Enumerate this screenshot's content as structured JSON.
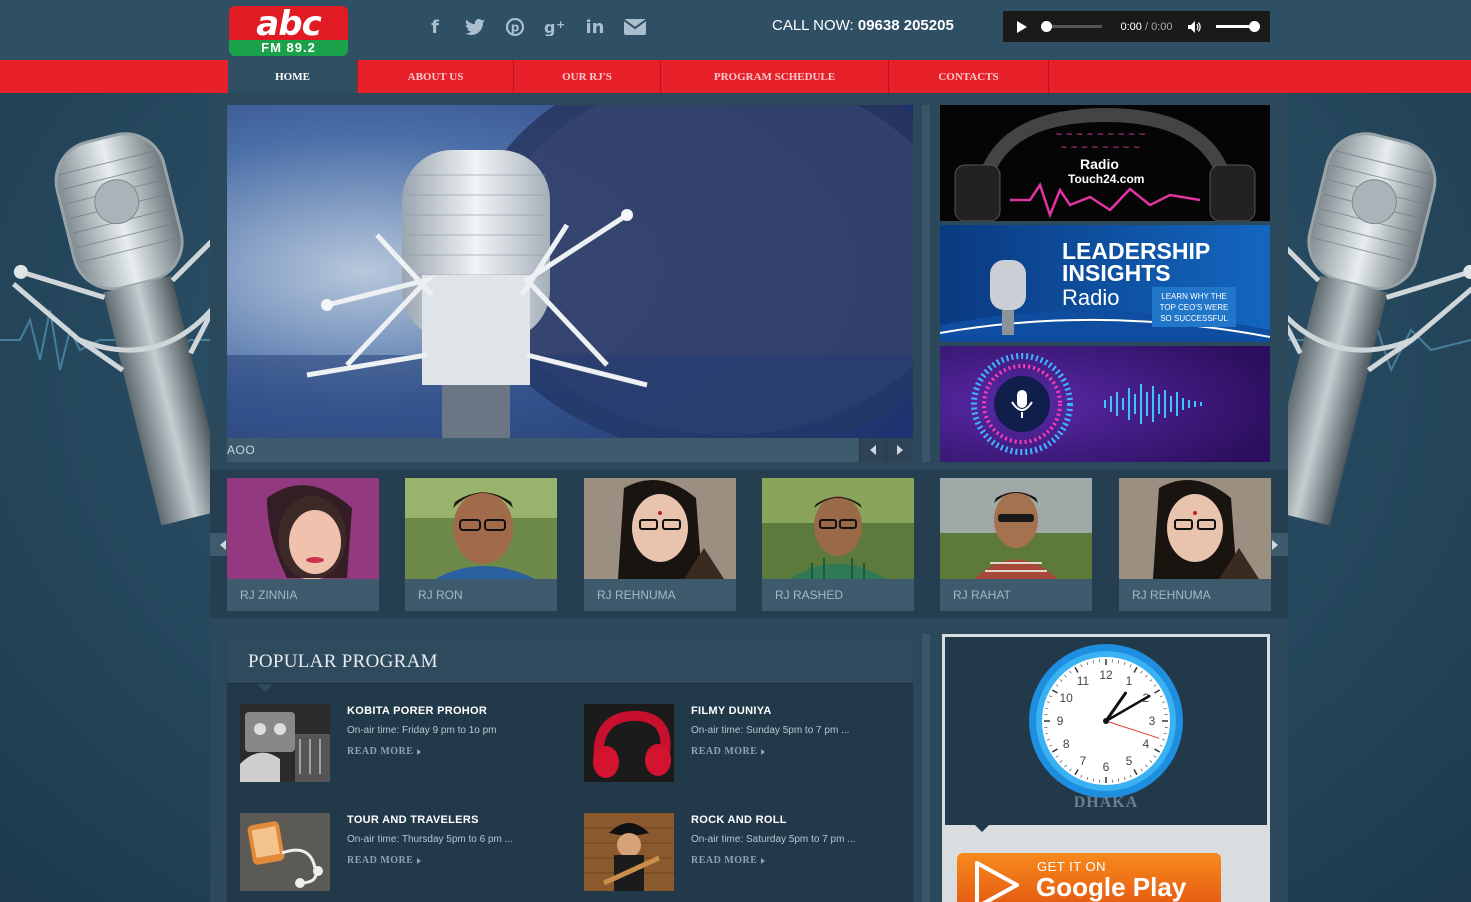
{
  "brand": {
    "logo_text": "abc",
    "logo_sub": "FM 89.2"
  },
  "header": {
    "call_label": "CALL NOW:",
    "call_number": "09638 205205",
    "social": [
      "facebook-icon",
      "twitter-icon",
      "pinterest-icon",
      "google-plus-icon",
      "linkedin-icon",
      "email-icon"
    ]
  },
  "player": {
    "current_time": "0:00",
    "separator": "/",
    "duration": "0:00",
    "progress": 0,
    "volume": 1.0
  },
  "nav": {
    "items": [
      {
        "label": "HOME",
        "active": true
      },
      {
        "label": "ABOUT US",
        "active": false
      },
      {
        "label": "OUR RJ'S",
        "active": false
      },
      {
        "label": "PROGRAM SCHEDULE",
        "active": false
      },
      {
        "label": "CONTACTS",
        "active": false
      }
    ]
  },
  "slider": {
    "caption": "AOO"
  },
  "ads": {
    "ad1_text_main": "Radio",
    "ad1_text_sub": "Touch24.com",
    "ad2_line1": "LEADERSHIP",
    "ad2_line2": "INSIGHTS",
    "ad2_line3": "Radio",
    "ad2_badge": "LEARN WHY THE TOP CEO'S WERE SO SUCCESSFUL"
  },
  "rjs": [
    {
      "name": "RJ ZINNIA"
    },
    {
      "name": "RJ RON"
    },
    {
      "name": "RJ REHNUMA"
    },
    {
      "name": "RJ RASHED"
    },
    {
      "name": "RJ RAHAT"
    },
    {
      "name": "RJ REHNUMA"
    }
  ],
  "popular": {
    "title": "POPULAR PROGRAM",
    "read_more": "READ MORE",
    "programs": [
      {
        "title": "KOBITA PORER PROHOR",
        "time": "On-air time: Friday 9 pm to 1o pm"
      },
      {
        "title": "FILMY DUNIYA",
        "time": "On-air time: Sunday 5pm to 7 pm ..."
      },
      {
        "title": "TOUR AND TRAVELERS",
        "time": "On-air time: Thursday 5pm to 6 pm ..."
      },
      {
        "title": "ROCK AND ROLL",
        "time": "On-air time: Saturday 5pm to 7 pm ..."
      }
    ]
  },
  "clock": {
    "city": "DHAKA",
    "hour": 1,
    "minute": 10,
    "second": 18
  },
  "store": {
    "get_it_on": "GET IT ON",
    "name": "Google Play"
  }
}
